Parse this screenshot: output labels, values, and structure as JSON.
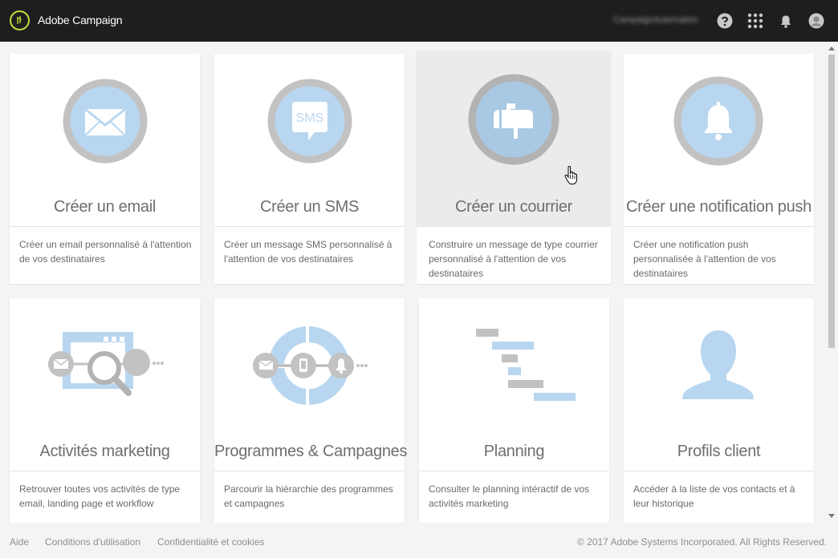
{
  "app": {
    "title": "Adobe Campaign",
    "org": "CampaignAutomation"
  },
  "cards": [
    {
      "title": "Créer un email",
      "desc": "Créer un email personnalisé à l'attention de vos destinataires",
      "icon": "envelope-icon"
    },
    {
      "title": "Créer un SMS",
      "desc": "Créer un message SMS personnalisé à l'attention de vos destinataires",
      "icon": "sms-icon",
      "icon_text": "SMS"
    },
    {
      "title": "Créer un courrier",
      "desc": "Construire un message de type courrier personnalisé à l'attention de vos destinataires",
      "icon": "mailbox-icon"
    },
    {
      "title": "Créer une notification push",
      "desc": "Créer une notification push personnalisée à l'attention de vos destinataires",
      "icon": "bell-icon"
    },
    {
      "title": "Activités marketing",
      "desc": "Retrouver toutes vos activités de type email, landing page et workflow",
      "icon": "marketing-activities-icon"
    },
    {
      "title": "Programmes & Campagnes",
      "desc": "Parcourir la hiérarchie des programmes et campagnes",
      "icon": "programs-campaigns-icon"
    },
    {
      "title": "Planning",
      "desc": "Consulter le planning intéractif de vos activités marketing",
      "icon": "gantt-planning-icon"
    },
    {
      "title": "Profils client",
      "desc": "Accéder à la liste de vos contacts et à leur historique",
      "icon": "customer-profile-icon"
    }
  ],
  "footer": {
    "help": "Aide",
    "terms": "Conditions d'utilisation",
    "privacy": "Confidentialité et cookies",
    "copyright": "© 2017 Adobe Systems Incorporated. All Rights Reserved."
  },
  "colors": {
    "topbar": "#1e1e1e",
    "accent": "#c4d83c",
    "icon_fill": "#b8d6ef",
    "ring": "#c2c2c2"
  }
}
